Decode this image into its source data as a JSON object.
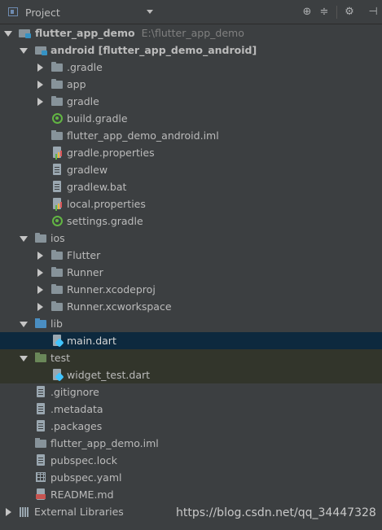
{
  "header": {
    "title": "Project",
    "tools": [
      "target-icon",
      "collapse-icon",
      "gear-icon",
      "minimize-icon"
    ]
  },
  "tree": {
    "root": {
      "label": "flutter_app_demo",
      "path": "E:\\flutter_app_demo"
    },
    "android": {
      "label": "android [flutter_app_demo_android]"
    },
    "android_items": [
      ".gradle",
      "app",
      "gradle",
      "build.gradle",
      "flutter_app_demo_android.iml",
      "gradle.properties",
      "gradlew",
      "gradlew.bat",
      "local.properties",
      "settings.gradle"
    ],
    "ios": {
      "label": "ios"
    },
    "ios_items": [
      "Flutter",
      "Runner",
      "Runner.xcodeproj",
      "Runner.xcworkspace"
    ],
    "lib": {
      "label": "lib"
    },
    "lib_items": [
      "main.dart"
    ],
    "test": {
      "label": "test"
    },
    "test_items": [
      "widget_test.dart"
    ],
    "root_files": [
      ".gitignore",
      ".metadata",
      ".packages",
      "flutter_app_demo.iml",
      "pubspec.lock",
      "pubspec.yaml",
      "README.md"
    ],
    "external": {
      "label": "External Libraries"
    }
  },
  "watermark": "https://blog.csdn.net/qq_34447328"
}
